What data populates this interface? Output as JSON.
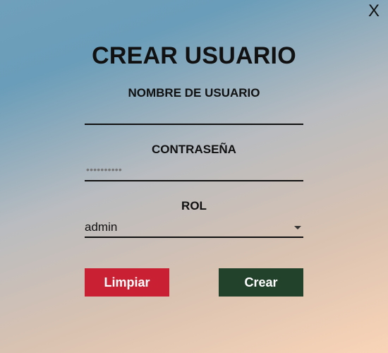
{
  "window": {
    "close_label": "X"
  },
  "form": {
    "title": "CREAR USUARIO",
    "username": {
      "label": "NOMBRE DE USUARIO",
      "value": ""
    },
    "password": {
      "label": "CONTRASEÑA",
      "masked_value": "••••••••••"
    },
    "role": {
      "label": "ROL",
      "selected": "admin"
    },
    "buttons": {
      "clear": "Limpiar",
      "create": "Crear"
    }
  },
  "colors": {
    "clear_button": "#c92133",
    "create_button": "#23422c"
  }
}
